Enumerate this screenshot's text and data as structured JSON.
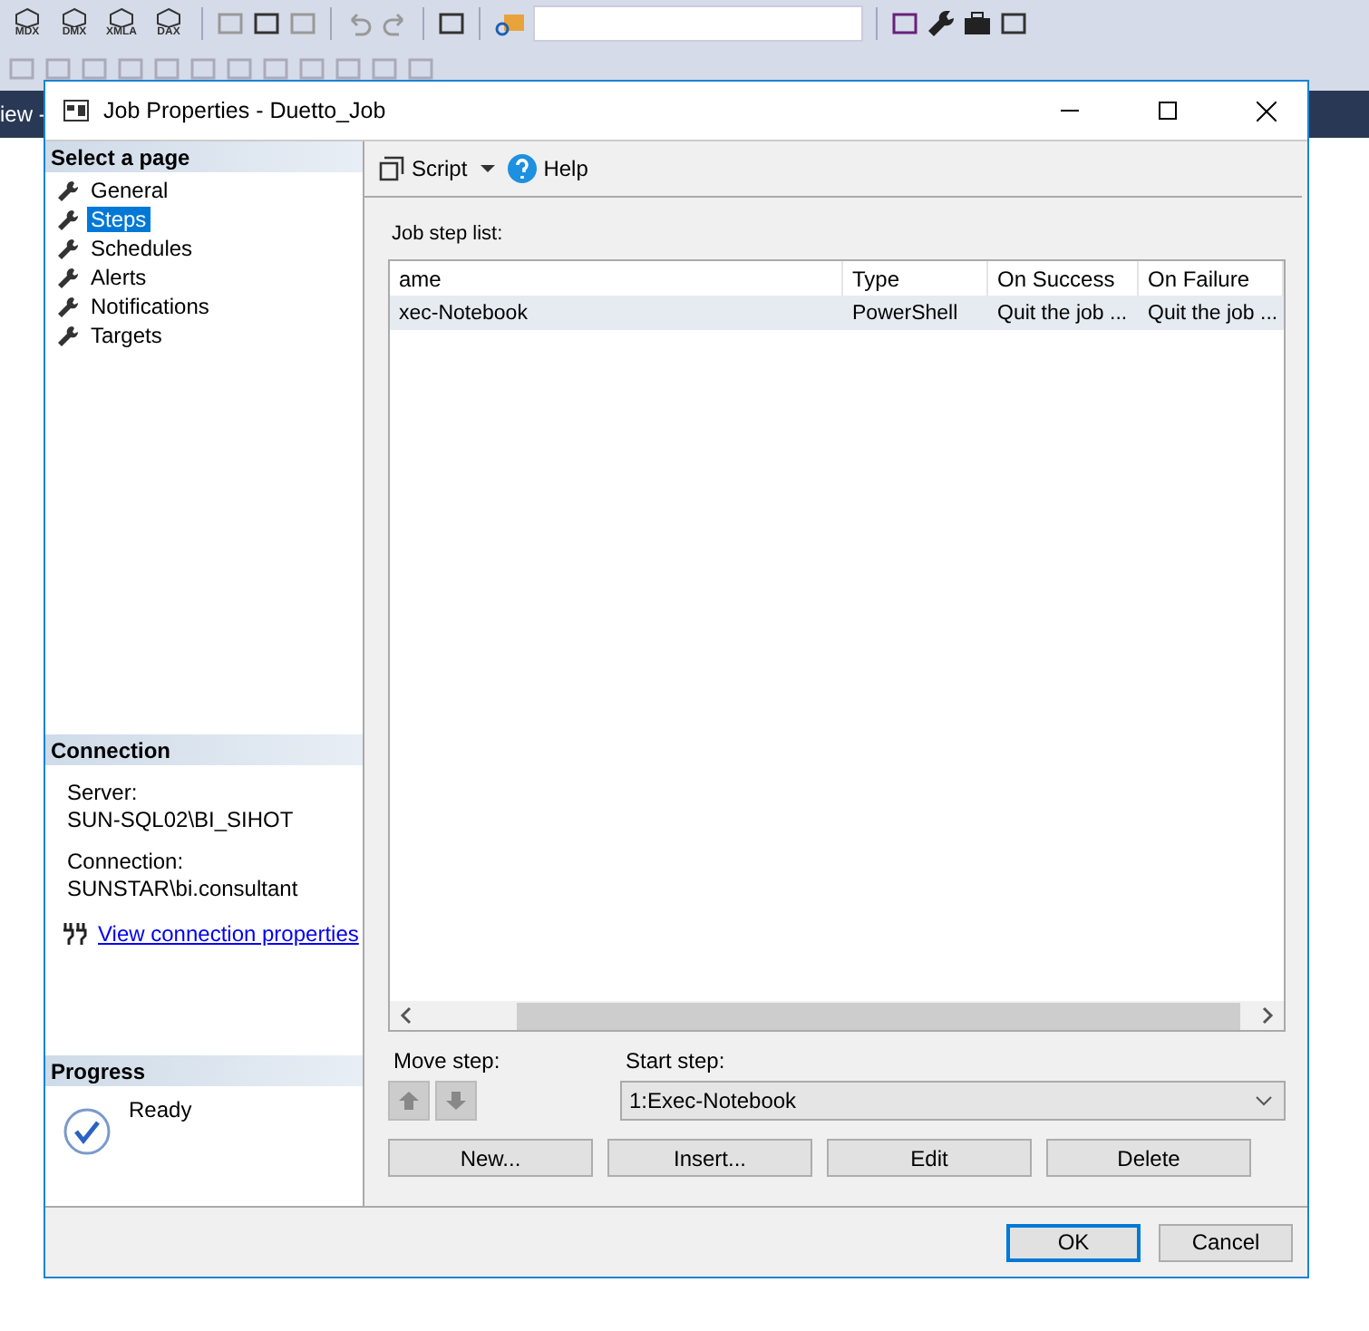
{
  "toolbar": {
    "labels": [
      "MDX",
      "DMX",
      "XMLA",
      "DAX"
    ]
  },
  "background_tab": {
    "title": "iew -"
  },
  "window": {
    "title": "Job Properties - Duetto_Job"
  },
  "sidebar": {
    "header": "Select a page",
    "items": [
      {
        "label": "General",
        "selected": false
      },
      {
        "label": "Steps",
        "selected": true
      },
      {
        "label": "Schedules",
        "selected": false
      },
      {
        "label": "Alerts",
        "selected": false
      },
      {
        "label": "Notifications",
        "selected": false
      },
      {
        "label": "Targets",
        "selected": false
      }
    ]
  },
  "connection": {
    "header": "Connection",
    "fields": [
      {
        "label": "Server:",
        "value": "SUN-SQL02\\BI_SIHOT"
      },
      {
        "label": "Connection:",
        "value": "SUNSTAR\\bi.consultant"
      }
    ],
    "link": "View connection properties"
  },
  "progress": {
    "header": "Progress",
    "status": "Ready"
  },
  "page_toolbar": {
    "script": "Script",
    "help": "Help"
  },
  "steps": {
    "label": "Job step list:",
    "columns": [
      "ame",
      "Type",
      "On Success",
      "On Failure"
    ],
    "rows": [
      {
        "cells": [
          "xec-Notebook",
          "PowerShell",
          "Quit the job ...",
          "Quit the job ..."
        ],
        "selected": true
      }
    ]
  },
  "move_step": {
    "label": "Move step:"
  },
  "start_step": {
    "label": "Start step:",
    "value": "1:Exec-Notebook"
  },
  "actions": [
    "New...",
    "Insert...",
    "Edit",
    "Delete"
  ],
  "buttons": [
    {
      "label": "OK",
      "default": true
    },
    {
      "label": "Cancel",
      "default": false
    }
  ]
}
